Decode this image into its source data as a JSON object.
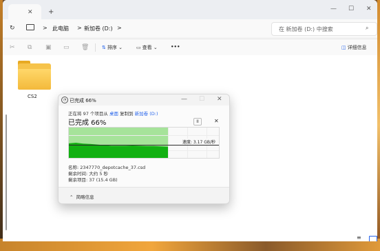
{
  "titlebar": {
    "tab_close": "✕",
    "new_tab": "+",
    "minimize": "—",
    "maximize": "☐",
    "close": "✕"
  },
  "nav": {
    "refresh": "↻",
    "breadcrumb": [
      "此电脑",
      "新加卷 (D:)"
    ],
    "separator": ">",
    "search_placeholder": "在 新加卷 (D:) 中搜索"
  },
  "toolbar": {
    "sort_label": "排序",
    "view_label": "查看",
    "more_label": "•••",
    "details_label": "详细信息"
  },
  "content": {
    "folder_name": "CS2"
  },
  "dialog": {
    "title": "已完成 66%",
    "line_prefix": "正在将 97 个项目从",
    "source": "桌面",
    "copy_word": "复制到",
    "destination": "新加卷 (D:)",
    "percent_label": "已完成 66%",
    "pause": "II",
    "cancel": "✕",
    "speed": "速度: 3.17 GB/秒",
    "name_line": "名称: 2347770_depotcache_37.csd",
    "time_line": "剩余时间: 大约 5 秒",
    "items_line": "剩余项目: 37 (15.4 GB)",
    "less_info": "简略信息"
  },
  "chart_data": {
    "type": "area",
    "progress": 0.66,
    "speed_level": 0.4,
    "speed_profile": [
      0.48,
      0.5,
      0.47,
      0.46,
      0.44,
      0.42,
      0.4,
      0.4,
      0.4,
      0.41,
      0.4,
      0.39,
      0.39,
      0.38,
      0.37
    ]
  }
}
